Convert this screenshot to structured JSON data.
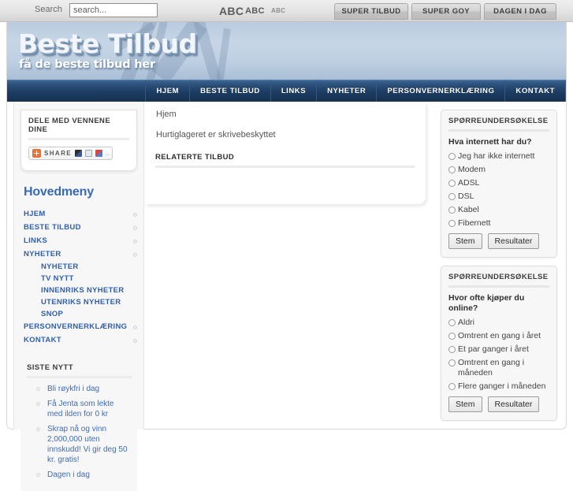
{
  "topbar": {
    "search_label": "Search",
    "search_value": "search...",
    "search_placeholder": "search...",
    "font_size_large": "ABC",
    "font_size_medium": "ABC",
    "font_size_small": "ABC",
    "buttons": [
      {
        "label": "SUPER TILBUD"
      },
      {
        "label": "SUPER GOY"
      },
      {
        "label": "DAGEN I DAG"
      }
    ]
  },
  "header": {
    "logo_title": "Beste Tilbud",
    "logo_subtitle": "få de beste tilbud her"
  },
  "nav": {
    "items": [
      {
        "label": "HJEM"
      },
      {
        "label": "BESTE TILBUD"
      },
      {
        "label": "LINKS"
      },
      {
        "label": "NYHETER"
      },
      {
        "label": "PERSONVERNERKLÆRING"
      },
      {
        "label": "KONTAKT"
      }
    ]
  },
  "sidebar_left": {
    "share_module": {
      "title": "DELE MED VENNENE DINE",
      "share_label": "SHARE",
      "dots": ".."
    },
    "mainmenu_title": "Hovedmeny",
    "menu": [
      {
        "label": "HJEM",
        "level": 1
      },
      {
        "label": "BESTE TILBUD",
        "level": 1
      },
      {
        "label": "LINKS",
        "level": 1
      },
      {
        "label": "NYHETER",
        "level": 1
      },
      {
        "label": "NYHETER",
        "level": 2
      },
      {
        "label": "TV NYTT",
        "level": 2
      },
      {
        "label": "INNENRIKS NYHETER",
        "level": 2
      },
      {
        "label": "UTENRIKS NYHETER",
        "level": 2
      },
      {
        "label": "SNOP",
        "level": 2
      },
      {
        "label": "PERSONVERNERKLÆRING",
        "level": 1
      },
      {
        "label": "KONTAKT",
        "level": 1
      }
    ],
    "latest_news_title": "SISTE NYTT",
    "latest_news": [
      {
        "label": "Bli røykfri i dag"
      },
      {
        "label": "Få Jenta som lekte med ilden for 0 kr"
      },
      {
        "label": "Skrap nå og vinn 2,000,000 uten innskudd! Vi gir deg 50 kr. gratis!"
      },
      {
        "label": "Dagen i dag"
      }
    ]
  },
  "main": {
    "breadcrumb": "Hjem",
    "message": "Hurtiglageret er skrivebeskyttet",
    "related_title": "RELATERTE TILBUD"
  },
  "sidebar_right": {
    "polls": [
      {
        "title": "SPØRREUNDERSØKELSE",
        "question": "Hva internett har du?",
        "options": [
          "Jeg har ikke internett",
          "Modem",
          "ADSL",
          "DSL",
          "Kabel",
          "Fibernett"
        ],
        "vote_label": "Stem",
        "results_label": "Resultater"
      },
      {
        "title": "SPØRREUNDERSØKELSE",
        "question": "Hvor ofte kjøper du online?",
        "options": [
          "Aldri",
          "Omtrent en gang i året",
          "Et par ganger i året",
          "Omtrent en gang i måneden",
          "Flere ganger i måneden"
        ],
        "vote_label": "Stem",
        "results_label": "Resultater"
      }
    ]
  },
  "colors": {
    "nav_dark_blue": "#1d3d63",
    "link_blue": "#2f5fae",
    "heading_blue": "#3b6ab5",
    "share_orange": "#ef6f2e",
    "header_blue": "#bdcfe2"
  }
}
